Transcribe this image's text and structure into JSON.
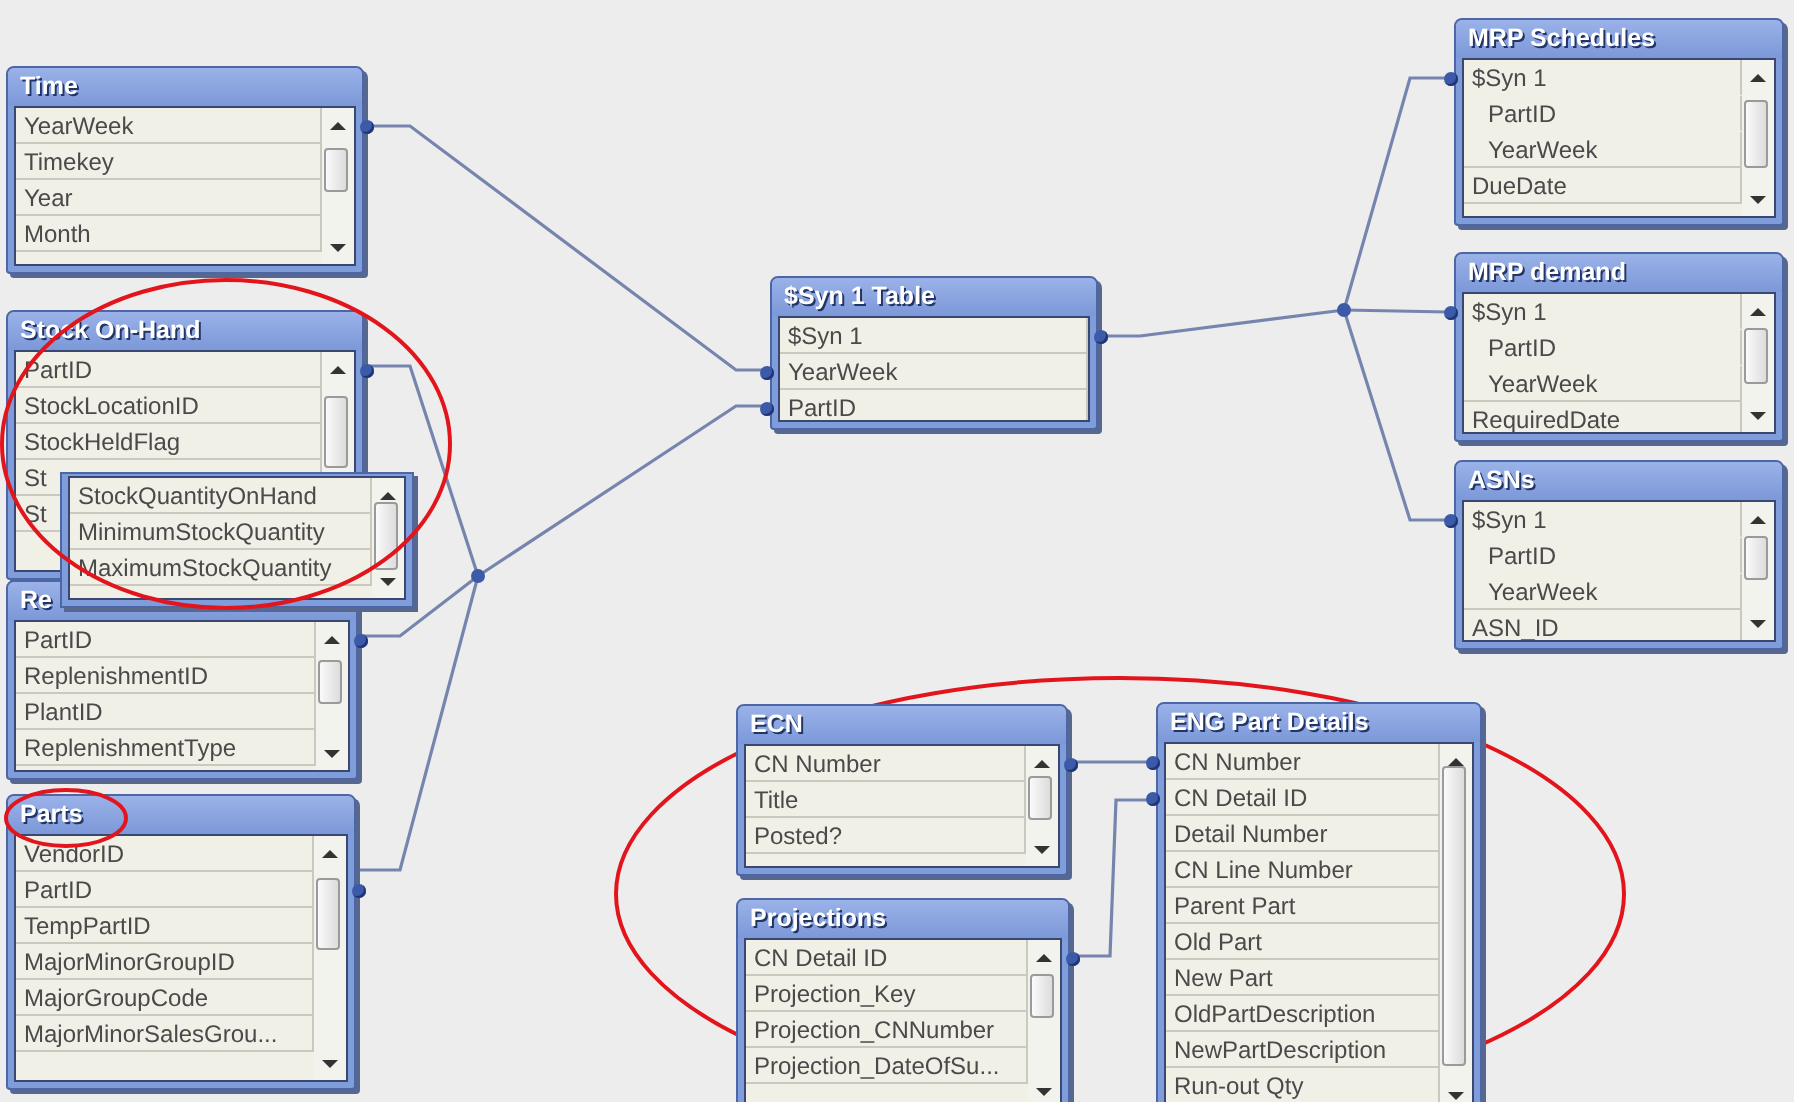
{
  "tables": [
    {
      "title": "Time",
      "fields": [
        {
          "name": "YearWeek",
          "linked": true
        },
        {
          "name": "Timekey"
        },
        {
          "name": "Year"
        },
        {
          "name": "Month"
        }
      ]
    },
    {
      "title": "Stock On-Hand",
      "fields": [
        {
          "name": "PartID",
          "linked": true
        },
        {
          "name": "StockLocationID"
        },
        {
          "name": "StockHeldFlag"
        },
        {
          "name": "St"
        },
        {
          "name": "St"
        }
      ]
    },
    {
      "fields": [
        {
          "name": "StockQuantityOnHand"
        },
        {
          "name": "MinimumStockQuantity"
        },
        {
          "name": "MaximumStockQuantity"
        }
      ]
    },
    {
      "title": "Re",
      "fields": [
        {
          "name": "PartID",
          "linked": true
        },
        {
          "name": "ReplenishmentID"
        },
        {
          "name": "PlantID"
        },
        {
          "name": "ReplenishmentType"
        }
      ]
    },
    {
      "title": "Parts",
      "fields": [
        {
          "name": "VendorID"
        },
        {
          "name": "PartID",
          "linked": true
        },
        {
          "name": "TempPartID"
        },
        {
          "name": "MajorMinorGroupID"
        },
        {
          "name": "MajorGroupCode"
        },
        {
          "name": "MajorMinorSalesGrou..."
        }
      ]
    },
    {
      "title": "$Syn 1 Table",
      "fields": [
        {
          "name": "$Syn 1",
          "linked": true
        },
        {
          "name": "YearWeek",
          "linked": true
        },
        {
          "name": "PartID",
          "linked": true
        }
      ]
    },
    {
      "title": "MRP Schedules",
      "fields": [
        {
          "name": "$Syn 1",
          "linked": true,
          "children": [
            {
              "name": "PartID"
            },
            {
              "name": "YearWeek"
            }
          ]
        },
        {
          "name": "DueDate"
        }
      ]
    },
    {
      "title": "MRP demand",
      "fields": [
        {
          "name": "$Syn 1",
          "linked": true,
          "children": [
            {
              "name": "PartID"
            },
            {
              "name": "YearWeek"
            }
          ]
        },
        {
          "name": "RequiredDate"
        }
      ]
    },
    {
      "title": "ASNs",
      "fields": [
        {
          "name": "$Syn 1",
          "linked": true,
          "children": [
            {
              "name": "PartID"
            },
            {
              "name": "YearWeek"
            }
          ]
        },
        {
          "name": "ASN_ID"
        }
      ]
    },
    {
      "title": "ECN",
      "fields": [
        {
          "name": "CN Number",
          "linked": true
        },
        {
          "name": "Title"
        },
        {
          "name": "Posted?"
        }
      ]
    },
    {
      "title": "Projections",
      "fields": [
        {
          "name": "CN Detail ID",
          "linked": true
        },
        {
          "name": "Projection_Key"
        },
        {
          "name": "Projection_CNNumber"
        },
        {
          "name": "Projection_DateOfSu..."
        }
      ]
    },
    {
      "title": "ENG Part Details",
      "fields": [
        {
          "name": "CN Number",
          "linked": true
        },
        {
          "name": "CN Detail ID",
          "linked": true
        },
        {
          "name": "Detail Number"
        },
        {
          "name": "CN Line Number"
        },
        {
          "name": "Parent Part"
        },
        {
          "name": "Old Part"
        },
        {
          "name": "New Part"
        },
        {
          "name": "OldPartDescription"
        },
        {
          "name": "NewPartDescription"
        },
        {
          "name": "Run-out Qty"
        }
      ]
    }
  ]
}
